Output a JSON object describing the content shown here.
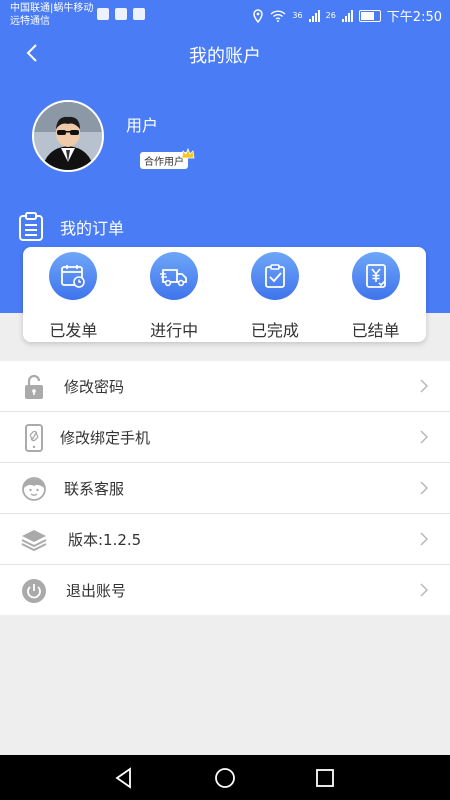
{
  "status_bar": {
    "carrier_line1": "中国联通|蜗牛移动",
    "carrier_line2": "远特通信",
    "net1": "36",
    "net2": "26",
    "time": "下午2:50"
  },
  "header": {
    "title": "我的账户"
  },
  "profile": {
    "name": "用户",
    "badge": "合作用户"
  },
  "orders": {
    "title": "我的订单",
    "items": [
      {
        "label": "已发单",
        "icon": "calendar-clock-icon"
      },
      {
        "label": "进行中",
        "icon": "truck-icon"
      },
      {
        "label": "已完成",
        "icon": "clipboard-check-icon"
      },
      {
        "label": "已结单",
        "icon": "yen-document-icon"
      }
    ]
  },
  "menu": [
    {
      "label": "修改密码",
      "icon": "lock-icon"
    },
    {
      "label": "修改绑定手机",
      "icon": "phone-link-icon"
    },
    {
      "label": "联系客服",
      "icon": "customer-service-icon"
    },
    {
      "label": "版本:1.2.5",
      "icon": "layers-icon"
    },
    {
      "label": "退出账号",
      "icon": "power-icon"
    }
  ],
  "colors": {
    "primary": "#4a7cf6",
    "background": "#eeeeee",
    "card": "#ffffff",
    "text": "#333333"
  }
}
